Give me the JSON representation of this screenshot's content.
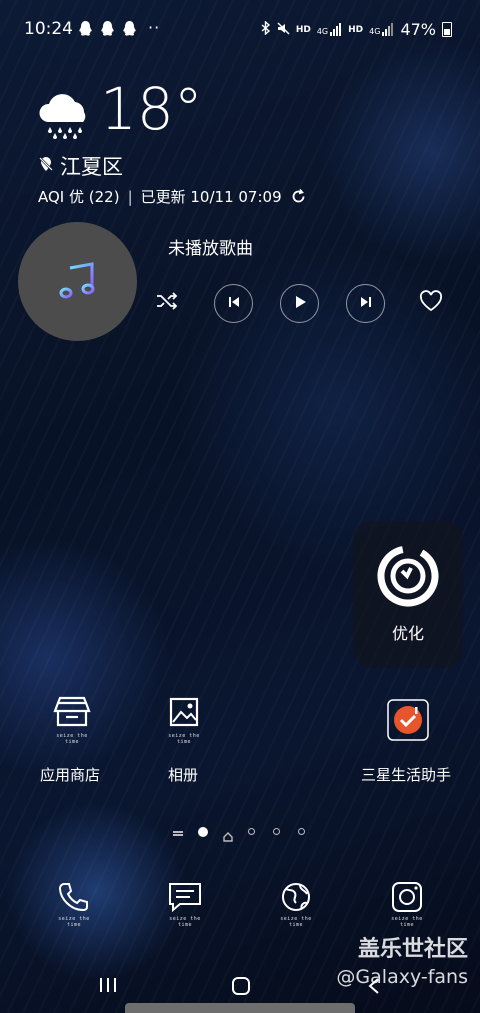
{
  "status_bar": {
    "time": "10:24",
    "dots": "··",
    "net1": "HD",
    "sig1": "4G",
    "net2": "HD",
    "sig2": "4G",
    "battery": "47%"
  },
  "weather": {
    "temperature": "18°",
    "location": "江夏区",
    "aqi": "AQI 优 (22)",
    "separator": "|",
    "updated": "已更新 10/11 07:09"
  },
  "music": {
    "song": "未播放歌曲"
  },
  "optimize_widget": {
    "label": "优化"
  },
  "apps": [
    {
      "label": "应用商店",
      "tiny": "seize the time"
    },
    {
      "label": "相册",
      "tiny": "seize the time"
    },
    {
      "label": "三星生活助手",
      "tiny": ""
    }
  ],
  "dock": {
    "tiny": "seize the time"
  },
  "watermark": {
    "line1": "盖乐世社区",
    "line2": "@Galaxy-fans"
  },
  "colors": {
    "accent_music": "#5aa0ff",
    "samsung_life_icon": "#e8552a"
  }
}
